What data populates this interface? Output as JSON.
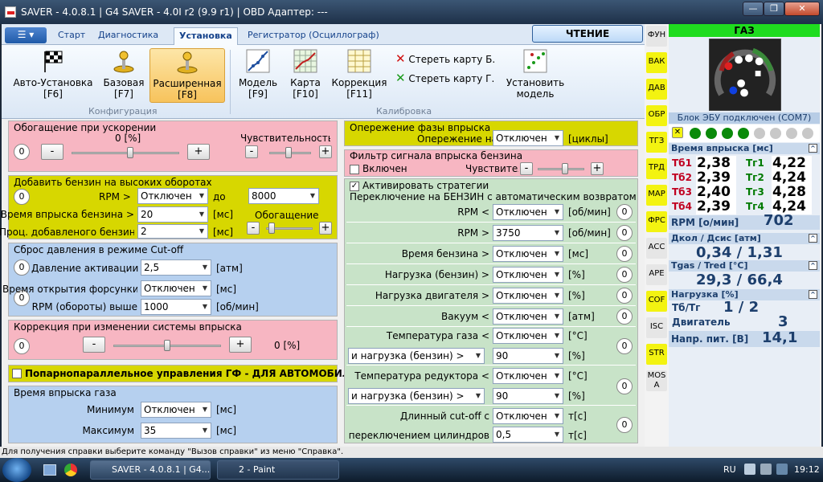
{
  "window": {
    "title": "SAVER - 4.0.8.1  |  G4 SAVER - 4.0I r2 (9.9 r1)  |  OBD Адаптер: ---",
    "minimize": "—",
    "maximize": "❐",
    "close": "✕"
  },
  "ribbon": {
    "app_menu": "☰ ▾",
    "tabs": [
      "Старт",
      "Диагностика",
      "Установка",
      "Регистратор (Осциллограф)"
    ],
    "read_button": "ЧТЕНИЕ",
    "config": {
      "label": "Конфигурация",
      "buttons": [
        {
          "l1": "Авто-Установка",
          "l2": "[F6]"
        },
        {
          "l1": "Базовая",
          "l2": "[F7]"
        },
        {
          "l1": "Расширенная",
          "l2": "[F8]"
        }
      ]
    },
    "calib": {
      "label": "Калибровка",
      "buttons": [
        {
          "l1": "Модель",
          "l2": "[F9]"
        },
        {
          "l1": "Карта",
          "l2": "[F10]"
        },
        {
          "l1": "Коррекция",
          "l2": "[F11]"
        }
      ],
      "erase_b": "Стереть карту Б.",
      "erase_g": "Стереть карту Г.",
      "install_1": "Установить",
      "install_2": "модель"
    }
  },
  "left": {
    "accel": {
      "title": "Обогащение при ускорении",
      "value": "0  [%]",
      "sens": "Чувствительность",
      "counter": "0",
      "minus": "-",
      "plus": "+",
      "slider_fraction": 0.55,
      "sens_fraction": 0.45
    },
    "high_rpm": {
      "title": "Добавить бензин на высоких оборотах",
      "counter": "0",
      "rpm_label": "RPM >",
      "rpm_value": "Отключен",
      "to_label": "до",
      "to_value": "8000",
      "time_label": "Время впрыска бензина >",
      "time_value": "20",
      "time_unit": "[мс]",
      "enrich_label": "Обогащение",
      "pct_label": "Проц. добавленого бензина",
      "pct_value": "2",
      "pct_unit": "[мс]",
      "minus": "-",
      "plus": "+",
      "slider_fraction": 0.05
    },
    "cutoff": {
      "title": "Сброс давления в режиме Cut-off",
      "counter1": "0",
      "counter2": "0",
      "press_label": "Давление активации",
      "press_value": "2,5",
      "press_unit": "[атм]",
      "time_label": "Время открытия форсунки",
      "time_value": "Отключен",
      "time_unit": "[мс]",
      "rpm_label": "RPM (обороты) выше",
      "rpm_value": "1000",
      "rpm_unit": "[об/мин]"
    },
    "inj_corr": {
      "title": "Коррекция при изменении системы впрыска",
      "counter": "0",
      "value": "0  [%]",
      "minus": "-",
      "plus": "+",
      "slider_fraction": 0.5
    },
    "parallel": {
      "label": "Попарнопараллельное управления ГФ - ДЛЯ АВТОМОБИЛЕЙ"
    },
    "gas_time": {
      "title": "Время впрыска газа",
      "min_label": "Минимум",
      "min_value": "Отключен",
      "min_unit": "[мс]",
      "max_label": "Максимум",
      "max_value": "35",
      "max_unit": "[мс]"
    }
  },
  "mid": {
    "phase": {
      "title": "Опережение фазы впрыска",
      "label": "Опережение на",
      "value": "Отключен",
      "unit": "[циклы]"
    },
    "filter": {
      "title": "Фильтр сигнала впрыска бензина",
      "enable": "Включен",
      "sens": "Чувствительность",
      "minus": "-",
      "plus": "+",
      "slider_fraction": 0.6
    },
    "strategy": {
      "activate": "Активировать стратегии",
      "title": "Переключение на БЕНЗИН с автоматическим возвратом на газ",
      "rows": [
        {
          "label": "RPM <",
          "value": "Отключен",
          "unit": "[об/мин]",
          "counter": "0"
        },
        {
          "label": "RPM >",
          "value": "3750",
          "unit": "[об/мин]",
          "counter": "0"
        },
        {
          "label": "Время бензина >",
          "value": "Отключен",
          "unit": "[мс]",
          "counter": "0"
        },
        {
          "label": "Нагрузка (бензин) >",
          "value": "Отключен",
          "unit": "[%]",
          "counter": "0"
        },
        {
          "label": "Нагрузка двигателя >",
          "value": "Отключен",
          "unit": "[%]",
          "counter": "0"
        },
        {
          "label": "Вакуум <",
          "value": "Отключен",
          "unit": "[атм]",
          "counter": "0"
        }
      ],
      "gas_temp": {
        "label": "Температура газа <",
        "value": "Отключен",
        "unit": "[°C]",
        "sub_label": "и нагрузка (бензин) >",
        "sub_value": "90",
        "sub_unit": "[%]",
        "counter": "0"
      },
      "red_temp": {
        "label": "Температура редуктора <",
        "value": "Отключен",
        "unit": "[°C]",
        "sub_label": "и нагрузка (бензин) >",
        "sub_value": "90",
        "sub_unit": "[%]",
        "counter": "0"
      },
      "long_cut": {
        "label": "Длинный cut-off с",
        "value": "Отключен",
        "unit": "т[с]",
        "sub_label": "переключением цилиндров",
        "sub_value": "0,5",
        "sub_unit": "т[с]",
        "counter": "0"
      }
    }
  },
  "vtabs": [
    "ФУН",
    "ВАК",
    "ДАВ",
    "ОБР",
    "ТГЗ",
    "ТРД",
    "МАР",
    "ФРС",
    "АСС",
    "АРЕ",
    "COF",
    "ISC",
    "STR",
    "MOS A"
  ],
  "right": {
    "gas": "ГАЗ",
    "ecu": "Блок ЭБУ подключен (COM7)",
    "inj_title": "Время впрыска [мс]",
    "inj": [
      {
        "tb": "Тб1",
        "b": "2,38",
        "tg": "Тг1",
        "g": "4,22"
      },
      {
        "tb": "Тб2",
        "b": "2,39",
        "tg": "Тг2",
        "g": "4,24"
      },
      {
        "tb": "Тб3",
        "b": "2,40",
        "tg": "Тг3",
        "g": "4,28"
      },
      {
        "tb": "Тб4",
        "b": "2,39",
        "tg": "Тг4",
        "g": "4,24"
      }
    ],
    "rpm_label": "RPM [о/мин]",
    "rpm": "702",
    "press_title": "Дкол / Дсис [атм]",
    "press": "0,34  /  1,31",
    "temp_title": "Tgas / Tred [°C]",
    "temp": "29,3  /  66,4",
    "load_title": "Нагрузка [%]",
    "load_l1": "Тб/Тг",
    "load_v1": "1     /     2",
    "load_l2": "Двигатель",
    "load_v2": "3",
    "volt_label": "Напр. пит. [В]",
    "volt": "14,1",
    "collapse": "^",
    "colors": {
      "gas_green": "#1fdc1f",
      "led_green": "#0a8a0a",
      "led_off": "#c8c8c8",
      "petrol_red": "#c00020",
      "gas_green_text": "#007a00"
    }
  },
  "statusbar": {
    "text": "Для получения справки выберите команду \"Вызов справки\" из меню \"Справка\"."
  },
  "taskbar": {
    "app1": "SAVER - 4.0.8.1  |  G4...",
    "app2": "2 - Paint",
    "lang": "RU",
    "clock": "19:12"
  }
}
